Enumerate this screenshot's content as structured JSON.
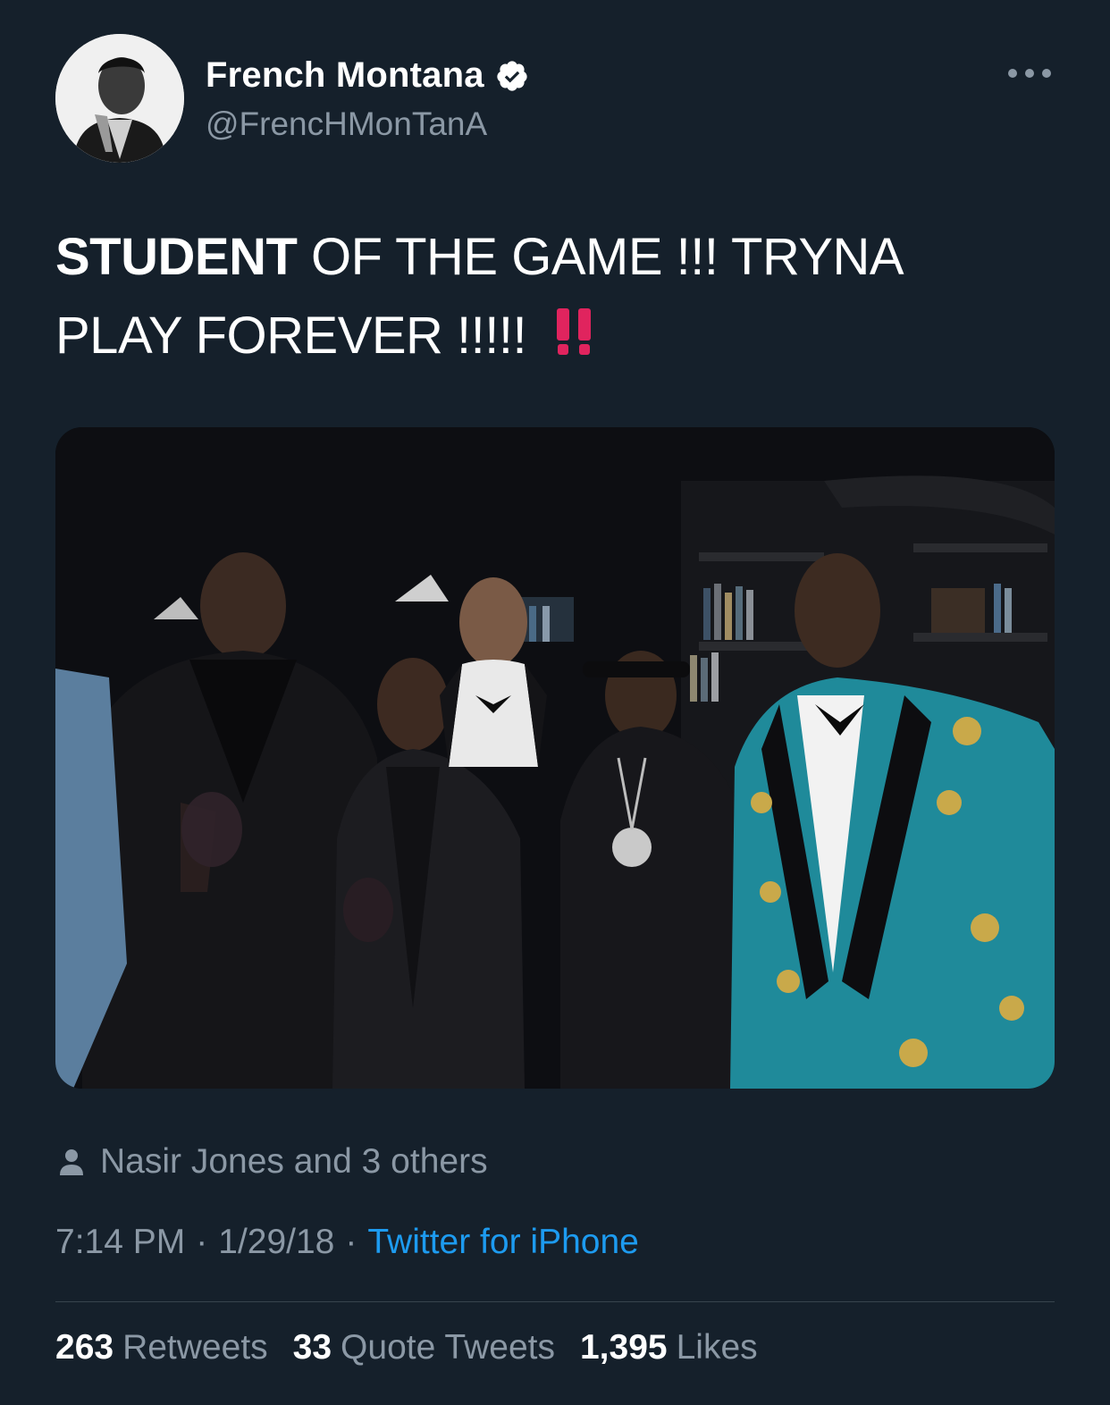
{
  "author": {
    "display_name": "French Montana",
    "handle": "@FrencHMonTanA",
    "verified": true,
    "avatar_icon": "profile-photo-avatar"
  },
  "menu": {
    "more_icon": "more-horizontal-icon"
  },
  "tweet": {
    "text_bold": "STUDENT",
    "text_rest": " OF THE GAME !!! TRYNA PLAY FOREVER !!!!! ",
    "emoji": "‼️"
  },
  "media": {
    "type": "photo",
    "description_icon": "group-photo"
  },
  "tagged": {
    "icon": "person-icon",
    "label": "Nasir Jones and 3 others"
  },
  "meta": {
    "time": "7:14 PM",
    "date": "1/29/18",
    "separator": "·",
    "source": "Twitter for iPhone"
  },
  "stats": {
    "retweets_count": "263",
    "retweets_label": "Retweets",
    "quotes_count": "33",
    "quotes_label": "Quote Tweets",
    "likes_count": "1,395",
    "likes_label": "Likes"
  },
  "colors": {
    "background": "#15202b",
    "text_primary": "#ffffff",
    "text_secondary": "#8b98a5",
    "link": "#1d9bf0",
    "divider": "#38444d",
    "emoji_red": "#e0245e"
  }
}
